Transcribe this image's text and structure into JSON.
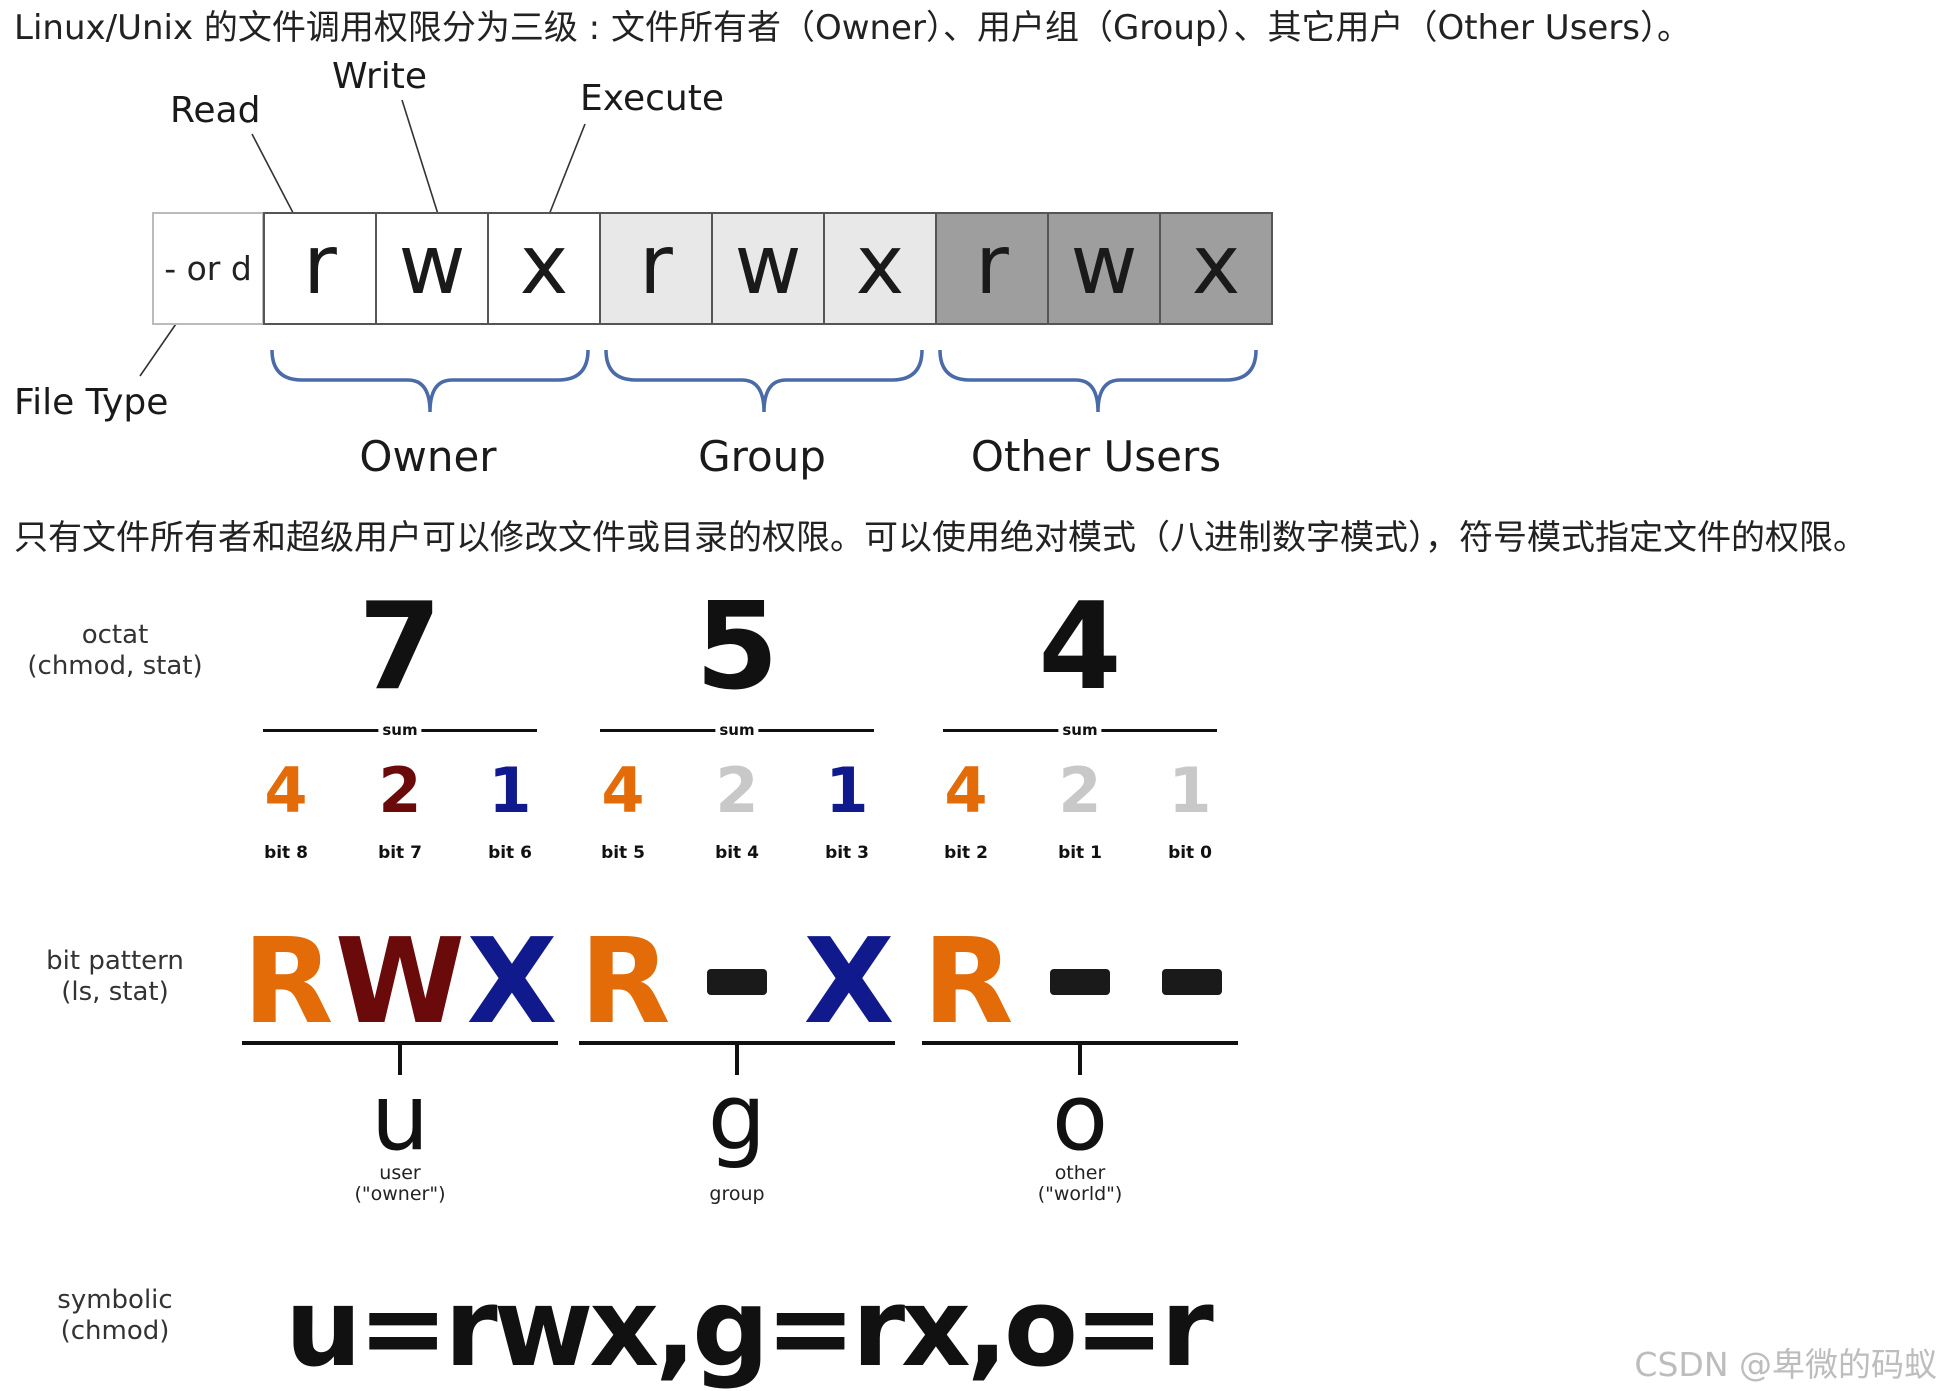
{
  "intro_text": "Linux/Unix 的文件调用权限分为三级 : 文件所有者（Owner）、用户组（Group）、其它用户（Other Users）。",
  "permission_diagram": {
    "file_type_cell": "- or d",
    "cells": [
      {
        "char": "r",
        "fill": "#ffffff"
      },
      {
        "char": "w",
        "fill": "#ffffff"
      },
      {
        "char": "x",
        "fill": "#ffffff"
      },
      {
        "char": "r",
        "fill": "#e8e8e8"
      },
      {
        "char": "w",
        "fill": "#e8e8e8"
      },
      {
        "char": "x",
        "fill": "#e8e8e8"
      },
      {
        "char": "r",
        "fill": "#9e9e9e"
      },
      {
        "char": "w",
        "fill": "#9e9e9e"
      },
      {
        "char": "x",
        "fill": "#9e9e9e"
      }
    ],
    "labels": {
      "read": "Read",
      "write": "Write",
      "execute": "Execute",
      "file_type": "File Type"
    },
    "groups": [
      "Owner",
      "Group",
      "Other Users"
    ],
    "brace_color": "#4a6aa8"
  },
  "middle_text": "只有文件所有者和超级用户可以修改文件或目录的权限。可以使用绝对模式（八进制数字模式），符号模式指定文件的权限。",
  "octal_diagram": {
    "row_labels": {
      "octat": [
        "octat",
        "(chmod, stat)"
      ],
      "bit_pattern": [
        "bit pattern",
        "(ls, stat)"
      ],
      "symbolic": [
        "symbolic",
        "(chmod)"
      ]
    },
    "sum_label": "sum",
    "groups": [
      {
        "octal": "7",
        "bits": [
          {
            "value": "4",
            "label": "bit 8",
            "color": "#e36c09"
          },
          {
            "value": "2",
            "label": "bit 7",
            "color": "#6b0a0a"
          },
          {
            "value": "1",
            "label": "bit 6",
            "color": "#101a8c"
          }
        ],
        "pattern": [
          {
            "char": "R",
            "color": "#e36c09"
          },
          {
            "char": "W",
            "color": "#6b0a0a"
          },
          {
            "char": "X",
            "color": "#101a8c"
          }
        ],
        "who": "u",
        "who_sub": [
          "user",
          "(\"owner\")"
        ]
      },
      {
        "octal": "5",
        "bits": [
          {
            "value": "4",
            "label": "bit 5",
            "color": "#e36c09"
          },
          {
            "value": "2",
            "label": "bit 4",
            "color": "#c8c8c8"
          },
          {
            "value": "1",
            "label": "bit 3",
            "color": "#101a8c"
          }
        ],
        "pattern": [
          {
            "char": "R",
            "color": "#e36c09"
          },
          {
            "char": "-",
            "color": "#1a1a1a"
          },
          {
            "char": "X",
            "color": "#101a8c"
          }
        ],
        "who": "g",
        "who_sub": [
          "group"
        ]
      },
      {
        "octal": "4",
        "bits": [
          {
            "value": "4",
            "label": "bit 2",
            "color": "#e36c09"
          },
          {
            "value": "2",
            "label": "bit 1",
            "color": "#c8c8c8"
          },
          {
            "value": "1",
            "label": "bit 0",
            "color": "#c8c8c8"
          }
        ],
        "pattern": [
          {
            "char": "R",
            "color": "#e36c09"
          },
          {
            "char": "-",
            "color": "#1a1a1a"
          },
          {
            "char": "-",
            "color": "#1a1a1a"
          }
        ],
        "who": "o",
        "who_sub": [
          "other",
          "(\"world\")"
        ]
      }
    ],
    "symbolic": "u=rwx,g=rx,o=r"
  },
  "watermark": "CSDN @卑微的码蚁"
}
